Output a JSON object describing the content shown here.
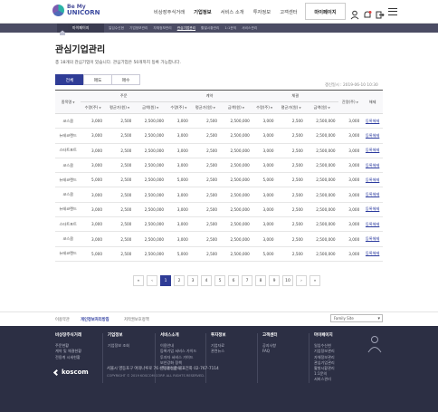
{
  "header": {
    "logo_top": "Be My",
    "logo_bottom": "UNICORN",
    "menu": [
      "비상장주식거래",
      "기업정보",
      "서비스 소개",
      "투자정보",
      "고객센터"
    ],
    "active_menu_index": 1,
    "mypage": "마이페이지"
  },
  "subnav": {
    "current": "마이페이지",
    "items": [
      "일임수신현",
      "기업정보관리",
      "자체정보관리",
      "관심기업관리",
      "활발시황관리",
      "1:1문의",
      "서비스관리"
    ],
    "active_index": 3
  },
  "page": {
    "title": "관심기업관리",
    "description": "총 18개의 관심기업이 있습니다. 관심기업은 50개까지 등록 가능합니다.",
    "updated": "갱신일시 : 2019-06-10 10:30"
  },
  "tabs": [
    "전체",
    "매도",
    "매수"
  ],
  "active_tab": 0,
  "table": {
    "col_company": "종목명",
    "group_labels": [
      "주문",
      "계약",
      "체결"
    ],
    "sub_labels": [
      "수량(주)",
      "평균가(원)",
      "금액(원)"
    ],
    "col_fee": "잔량(주)",
    "col_action": "해제",
    "rows": [
      {
        "name": "코스콤",
        "qty": "3,000",
        "price": "2,500",
        "amount": "2,500,000"
      },
      {
        "name": "뉴테코랜드",
        "qty": "3,000",
        "price": "2,500",
        "amount": "2,500,000"
      },
      {
        "name": "스타트포트",
        "qty": "3,000",
        "price": "2,500",
        "amount": "2,500,000"
      },
      {
        "name": "코스콤",
        "qty": "3,000",
        "price": "2,500",
        "amount": "2,500,000"
      },
      {
        "name": "뉴테코랜드",
        "qty": "5,000",
        "price": "2,500",
        "amount": "2,500,000"
      },
      {
        "name": "코스콤",
        "qty": "3,000",
        "price": "2,500",
        "amount": "2,500,000"
      },
      {
        "name": "뉴테코랜드",
        "qty": "3,000",
        "price": "2,500",
        "amount": "2,500,000"
      },
      {
        "name": "스타트포트",
        "qty": "3,000",
        "price": "2,500",
        "amount": "2,500,000"
      },
      {
        "name": "코스콤",
        "qty": "3,000",
        "price": "2,500",
        "amount": "2,500,000"
      },
      {
        "name": "뉴테코랜드",
        "qty": "5,000",
        "price": "2,500",
        "amount": "2,500,000"
      }
    ],
    "remain": "3,000",
    "action_label": "등록해제"
  },
  "pagination": {
    "first": "«",
    "prev": "‹",
    "pages": [
      "1",
      "2",
      "3",
      "4",
      "5",
      "6",
      "7",
      "8",
      "9",
      "10"
    ],
    "active_page": 0,
    "next": "›",
    "last": "»"
  },
  "footer_links": [
    "이용약관",
    "개인정보처리방침",
    "저작권보호정책"
  ],
  "family_site": "Family Site",
  "footer_cols": [
    {
      "title": "비상장주식거래",
      "items": [
        "주문현황",
        "계약 및 체결현황",
        "전용계 시세현황"
      ]
    },
    {
      "title": "기업정보",
      "items": [
        "기업정보 조회"
      ]
    },
    {
      "title": "서비스소개",
      "items": [
        "이용안내",
        "등록기업 서비스 가이드",
        "투자자 서비스 가이드",
        "보안강화 정책",
        "인증방법안내"
      ]
    },
    {
      "title": "투자정보",
      "items": [
        "기업자료",
        "관련뉴스"
      ]
    },
    {
      "title": "고객센터",
      "items": [
        "공지사항",
        "FAQ"
      ]
    },
    {
      "title": "마이페이지",
      "items": [
        "일임수신현",
        "기업정보관리",
        "자체정보관리",
        "관심기업관리",
        "활발시황관리",
        "1:1문의",
        "서비스관리"
      ]
    }
  ],
  "footer_logo": "koscom",
  "footer_address": "서울시 영등포구 여의나루로 76 (주)코스콤   대표전화 02-767-7114",
  "footer_copy": "COPYRIGHT © 2019 KOSCOM CORP. ALL RIGHTS RESERVED.",
  "colors": {
    "primary": "#2f3c96",
    "footer_bg": "#2c2f44",
    "subnav_bg": "#4b4c64"
  },
  "icons": [
    "user-icon",
    "bell-icon",
    "logout-icon",
    "menu-icon",
    "home-icon",
    "person-icon"
  ]
}
